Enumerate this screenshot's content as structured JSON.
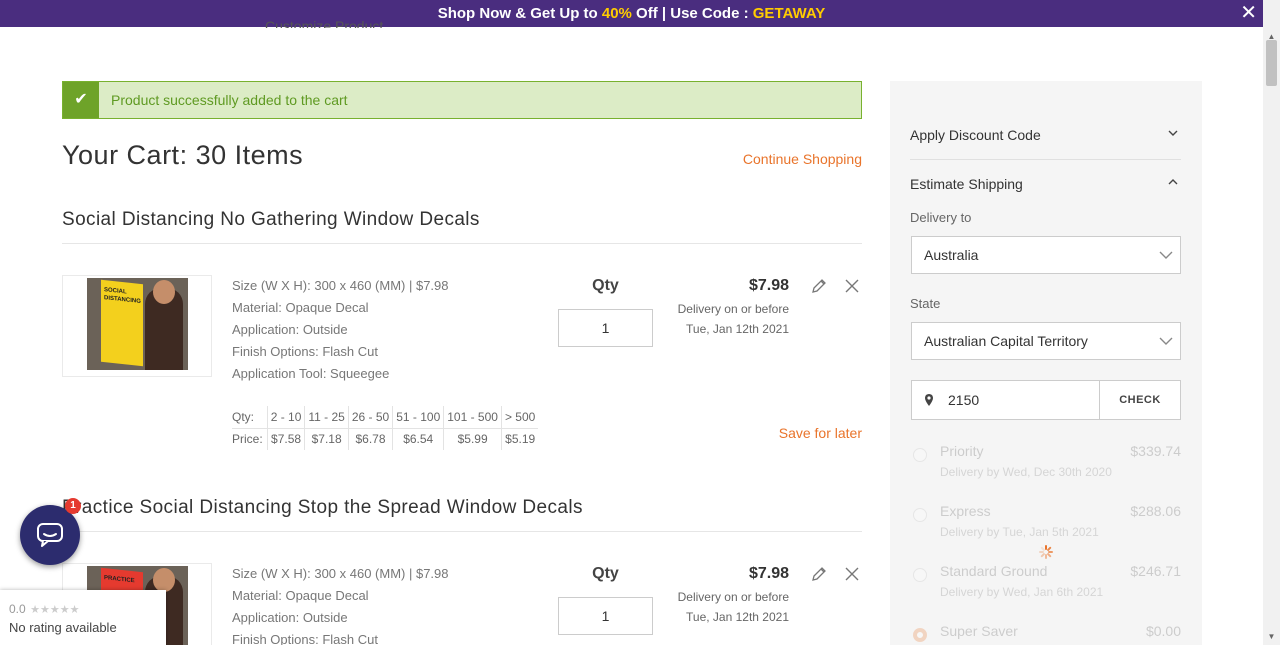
{
  "promo": {
    "prefix": "Shop Now & Get Up to ",
    "discount": "40%",
    "middle": " Off | Use Code : ",
    "code": "GETAWAY",
    "close": "✕"
  },
  "breadcrumb_cut": "Customize Product",
  "alert": {
    "message": "Product successfully added to the cart"
  },
  "cart": {
    "title": "Your Cart: 30 Items",
    "continue_label": "Continue Shopping",
    "qty_header": "Qty",
    "save_later": "Save for later",
    "items": [
      {
        "title": "Social Distancing No Gathering Window Decals",
        "specs": [
          "Size (W X H): 300 x 460 (MM) | $7.98",
          "Material: Opaque Decal",
          "Application: Outside",
          "Finish Options: Flash Cut",
          "Application Tool: Squeegee"
        ],
        "qty": "1",
        "price": "$7.98",
        "delivery_line1": "Delivery on or before",
        "delivery_line2": "Tue, Jan 12th 2021",
        "thumb_text": "SOCIAL DISTANCING"
      },
      {
        "title": "Practice Social Distancing Stop the Spread Window Decals",
        "specs": [
          "Size (W X H): 300 x 460 (MM) | $7.98",
          "Material: Opaque Decal",
          "Application: Outside",
          "Finish Options: Flash Cut"
        ],
        "qty": "1",
        "price": "$7.98",
        "delivery_line1": "Delivery on or before",
        "delivery_line2": "Tue, Jan 12th 2021",
        "thumb_text": "PRACTICE"
      }
    ],
    "tier": {
      "qty_label": "Qty:",
      "price_label": "Price:",
      "qty": [
        "2 - 10",
        "11 - 25",
        "26 - 50",
        "51 - 100",
        "101 - 500",
        "> 500"
      ],
      "price": [
        "$7.58",
        "$7.18",
        "$6.78",
        "$6.54",
        "$5.99",
        "$5.19"
      ]
    }
  },
  "sidebar": {
    "discount_label": "Apply Discount Code",
    "shipping_label": "Estimate Shipping",
    "delivery_to_label": "Delivery to",
    "country": "Australia",
    "state_label": "State",
    "state": "Australian Capital Territory",
    "zip": "2150",
    "check_label": "CHECK",
    "options": [
      {
        "name": "Priority",
        "date": "Delivery by Wed, Dec 30th 2020",
        "price": "$339.74"
      },
      {
        "name": "Express",
        "date": "Delivery by Tue, Jan 5th 2021",
        "price": "$288.06"
      },
      {
        "name": "Standard Ground",
        "date": "Delivery by Wed, Jan 6th 2021",
        "price": "$246.71"
      },
      {
        "name": "Super Saver",
        "date": "",
        "price": "$0.00"
      }
    ]
  },
  "chat": {
    "badge": "1"
  },
  "rating": {
    "score": "0.0",
    "stars": "★★★★★",
    "text": "No rating available"
  },
  "colors": {
    "promo_bg": "#4a2d7f",
    "accent": "#e9742b",
    "success": "#6ea329",
    "highlight": "#ffcc00"
  }
}
